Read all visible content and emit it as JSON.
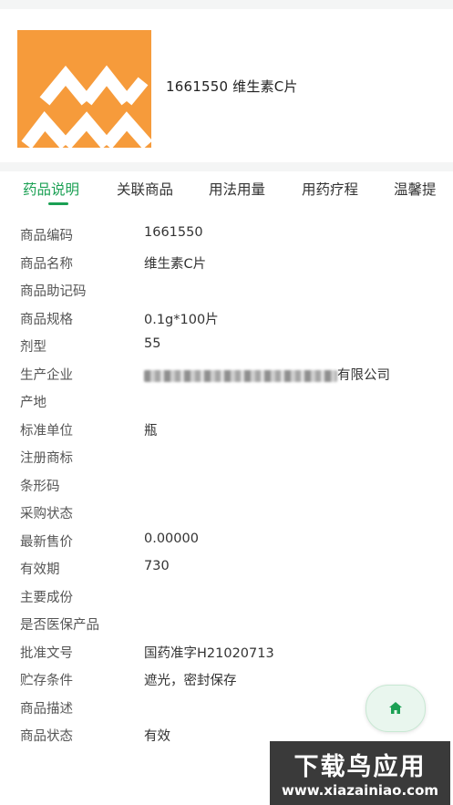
{
  "product": {
    "thumbnail_icon": "chevron-logo-icon",
    "title": "1661550 维生素C片",
    "thumbnail_color": "#f69b3b"
  },
  "tabs": [
    {
      "label": "药品说明",
      "active": true
    },
    {
      "label": "关联商品",
      "active": false
    },
    {
      "label": "用法用量",
      "active": false
    },
    {
      "label": "用药疗程",
      "active": false
    },
    {
      "label": "温馨提",
      "active": false
    }
  ],
  "accent_color": "#1aa053",
  "details": [
    {
      "label": "商品编码",
      "value": "1661550"
    },
    {
      "label": "商品名称",
      "value": "维生素C片"
    },
    {
      "label": "商品助记码",
      "value": ""
    },
    {
      "label": "商品规格",
      "value": "0.1g*100片"
    },
    {
      "label": "剂型",
      "value": "55"
    },
    {
      "label": "生产企业",
      "value": "有限公司"
    },
    {
      "label": "产地",
      "value": ""
    },
    {
      "label": "标准单位",
      "value": "瓶"
    },
    {
      "label": "注册商标",
      "value": ""
    },
    {
      "label": "条形码",
      "value": ""
    },
    {
      "label": "采购状态",
      "value": ""
    },
    {
      "label": "最新售价",
      "value": "0.00000"
    },
    {
      "label": "有效期",
      "value": "730"
    },
    {
      "label": "主要成份",
      "value": ""
    },
    {
      "label": "是否医保产品",
      "value": ""
    },
    {
      "label": "批准文号",
      "value": "国药准字H21020713"
    },
    {
      "label": "贮存条件",
      "value": "遮光，密封保存"
    },
    {
      "label": "商品描述",
      "value": ""
    },
    {
      "label": "商品状态",
      "value": "有效"
    }
  ],
  "home_button": {
    "icon": "home-icon"
  },
  "watermark": {
    "title": "下载鸟应用",
    "url": "www.xiazainiao.com"
  }
}
